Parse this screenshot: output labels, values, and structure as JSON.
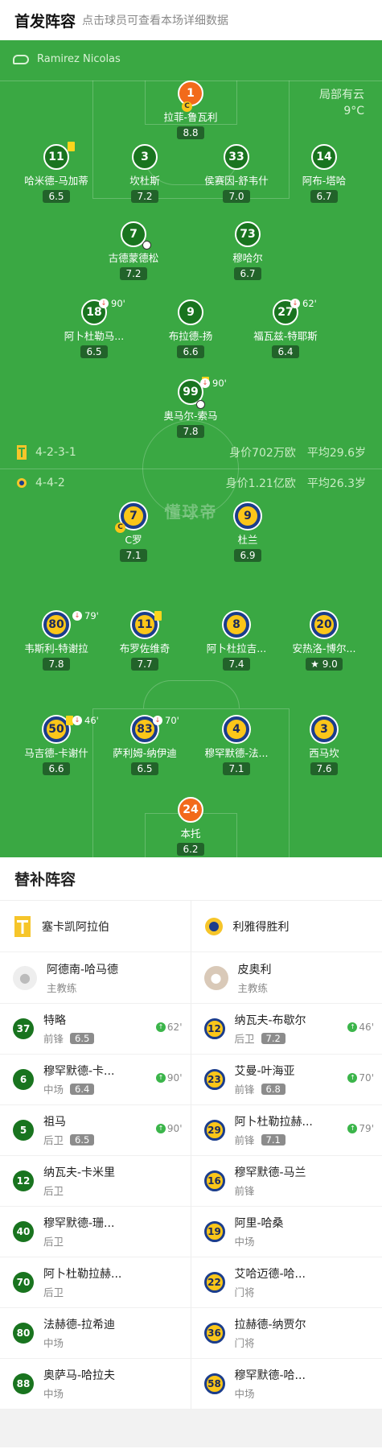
{
  "header": {
    "title": "首发阵容",
    "subtitle": "点击球员可查看本场详细数据"
  },
  "referee": "Ramirez Nicolas",
  "weather": {
    "condition": "局部有云",
    "temp": "9°C"
  },
  "watermark": "懂球帝",
  "home": {
    "formation": "4-2-3-1",
    "value": "身价702万欧",
    "age": "平均29.6岁",
    "players": [
      {
        "num": "1",
        "name": "拉菲-鲁瓦利",
        "rating": "8.8"
      },
      {
        "num": "11",
        "name": "哈米德-马加蒂",
        "rating": "6.5"
      },
      {
        "num": "3",
        "name": "坎杜斯",
        "rating": "7.2"
      },
      {
        "num": "33",
        "name": "侯赛因-舒韦什",
        "rating": "7.0"
      },
      {
        "num": "14",
        "name": "阿布-塔哈",
        "rating": "6.7"
      },
      {
        "num": "7",
        "name": "古德蒙德松",
        "rating": "7.2"
      },
      {
        "num": "73",
        "name": "穆哈尔",
        "rating": "6.7"
      },
      {
        "num": "18",
        "name": "阿卜杜勒马...",
        "rating": "6.5",
        "sub": "90'"
      },
      {
        "num": "9",
        "name": "布拉德-扬",
        "rating": "6.6"
      },
      {
        "num": "27",
        "name": "福瓦兹-特耶斯",
        "rating": "6.4",
        "sub": "62'"
      },
      {
        "num": "99",
        "name": "奥马尔-索马",
        "rating": "7.8",
        "sub": "90'"
      }
    ]
  },
  "away": {
    "formation": "4-4-2",
    "value": "身价1.21亿欧",
    "age": "平均26.3岁",
    "players": [
      {
        "num": "7",
        "name": "C罗",
        "rating": "7.1"
      },
      {
        "num": "9",
        "name": "杜兰",
        "rating": "6.9"
      },
      {
        "num": "80",
        "name": "韦斯利-特谢拉",
        "rating": "7.8",
        "sub": "79'"
      },
      {
        "num": "11",
        "name": "布罗佐维奇",
        "rating": "7.7"
      },
      {
        "num": "8",
        "name": "阿卜杜拉吉...",
        "rating": "7.4"
      },
      {
        "num": "20",
        "name": "安热洛-博尔...",
        "rating": "9.0"
      },
      {
        "num": "50",
        "name": "马吉德-卡谢什",
        "rating": "6.6",
        "sub": "46'"
      },
      {
        "num": "83",
        "name": "萨利姆-纳伊迪",
        "rating": "6.5",
        "sub": "70'"
      },
      {
        "num": "4",
        "name": "穆罕默德-法...",
        "rating": "7.1"
      },
      {
        "num": "3",
        "name": "西马坎",
        "rating": "7.6"
      },
      {
        "num": "24",
        "name": "本托",
        "rating": "6.2"
      }
    ]
  },
  "subs_title": "替补阵容",
  "subs": {
    "home_team": "塞卡凯阿拉伯",
    "away_team": "利雅得胜利",
    "home_coach": {
      "name": "阿德南-哈马德",
      "role": "主教练"
    },
    "away_coach": {
      "name": "皮奥利",
      "role": "主教练"
    },
    "home": [
      {
        "num": "37",
        "name": "特略",
        "pos": "前锋",
        "rating": "6.5",
        "ev": "62'"
      },
      {
        "num": "6",
        "name": "穆罕默德-卡...",
        "pos": "中场",
        "rating": "6.4",
        "ev": "90'"
      },
      {
        "num": "5",
        "name": "祖马",
        "pos": "后卫",
        "rating": "6.5",
        "ev": "90'"
      },
      {
        "num": "12",
        "name": "纳瓦夫-卡米里",
        "pos": "后卫"
      },
      {
        "num": "40",
        "name": "穆罕默德-珊...",
        "pos": "后卫"
      },
      {
        "num": "70",
        "name": "阿卜杜勒拉赫...",
        "pos": "后卫"
      },
      {
        "num": "80",
        "name": "法赫德-拉希迪",
        "pos": "中场"
      },
      {
        "num": "88",
        "name": "奥萨马-哈拉夫",
        "pos": "中场"
      }
    ],
    "away": [
      {
        "num": "12",
        "name": "纳瓦夫-布歇尔",
        "pos": "后卫",
        "rating": "7.2",
        "ev": "46'"
      },
      {
        "num": "23",
        "name": "艾曼-叶海亚",
        "pos": "前锋",
        "rating": "6.8",
        "ev": "70'"
      },
      {
        "num": "29",
        "name": "阿卜杜勒拉赫...",
        "pos": "前锋",
        "rating": "7.1",
        "ev": "79'"
      },
      {
        "num": "16",
        "name": "穆罕默德-马兰",
        "pos": "前锋"
      },
      {
        "num": "19",
        "name": "阿里-哈桑",
        "pos": "中场"
      },
      {
        "num": "22",
        "name": "艾哈迈德-哈...",
        "pos": "门将"
      },
      {
        "num": "36",
        "name": "拉赫德-纳贾尔",
        "pos": "门将"
      },
      {
        "num": "58",
        "name": "穆罕默德-哈...",
        "pos": "中场"
      }
    ]
  }
}
